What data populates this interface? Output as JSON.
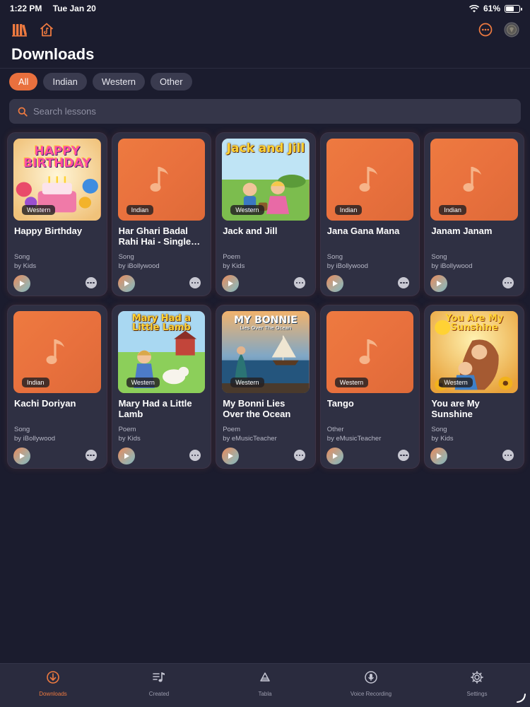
{
  "status": {
    "time": "1:22 PM",
    "date": "Tue Jan 20",
    "battery": "61%",
    "battery_level": 0.61
  },
  "toolbar": {
    "library_icon": "library-icon",
    "home_icon": "home-icon",
    "more_icon": "ellipsis-circle-icon",
    "profile_icon": "avatar"
  },
  "page_title": "Downloads",
  "filters": [
    "All",
    "Indian",
    "Western",
    "Other"
  ],
  "active_filter": "All",
  "search": {
    "placeholder": "Search lessons"
  },
  "lessons": [
    {
      "title": "Happy Birthday",
      "category": "Western",
      "type": "Song",
      "author": "by Kids",
      "cover": "happy-birthday",
      "cover_text": "HAPPY BIRTHDAY"
    },
    {
      "title": "Har Ghari Badal Rahi Hai - Single…",
      "category": "Indian",
      "type": "Song",
      "author": "by iBollywood",
      "cover": "placeholder"
    },
    {
      "title": "Jack and Jill",
      "category": "Western",
      "type": "Poem",
      "author": "by Kids",
      "cover": "jack-and-jill",
      "cover_text": "Jack and Jill"
    },
    {
      "title": "Jana Gana Mana",
      "category": "Indian",
      "type": "Song",
      "author": "by iBollywood",
      "cover": "placeholder"
    },
    {
      "title": "Janam Janam",
      "category": "Indian",
      "type": "Song",
      "author": "by iBollywood",
      "cover": "placeholder"
    },
    {
      "title": "Kachi Doriyan",
      "category": "Indian",
      "type": "Song",
      "author": "by iBollywood",
      "cover": "placeholder"
    },
    {
      "title": "Mary Had a Little Lamb",
      "category": "Western",
      "type": "Poem",
      "author": "by Kids",
      "cover": "mary-lamb",
      "cover_text": "Mary Had a Little Lamb"
    },
    {
      "title": "My Bonni Lies Over the Ocean",
      "category": "Western",
      "type": "Poem",
      "author": "by eMusicTeacher",
      "cover": "my-bonnie",
      "cover_text": "MY BONNIE",
      "cover_subtext": "Lies Over The Ocean"
    },
    {
      "title": "Tango",
      "category": "Western",
      "type": "Other",
      "author": "by eMusicTeacher",
      "cover": "placeholder"
    },
    {
      "title": "You are My Sunshine",
      "category": "Western",
      "type": "Song",
      "author": "by Kids",
      "cover": "sunshine",
      "cover_text": "You Are My Sunshine"
    }
  ],
  "tabs": [
    {
      "label": "Downloads",
      "icon": "download-circle-icon",
      "active": true
    },
    {
      "label": "Created",
      "icon": "music-list-icon",
      "active": false
    },
    {
      "label": "Tabla",
      "icon": "tabla-icon",
      "active": false
    },
    {
      "label": "Voice Recording",
      "icon": "microphone-icon",
      "active": false
    },
    {
      "label": "Settings",
      "icon": "gear-icon",
      "active": false
    }
  ],
  "colors": {
    "accent": "#ee7a40",
    "background": "#1b1c2e",
    "card": "#2f3043"
  }
}
